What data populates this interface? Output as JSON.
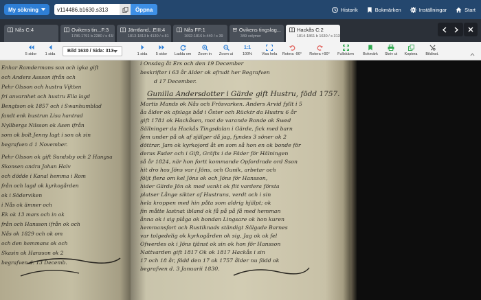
{
  "topbar": {
    "my_search_label": "My sökning",
    "search_value": "v114486.b1630.s313",
    "open_label": "Öppna",
    "links": [
      {
        "label": "Historik",
        "icon": "history-icon"
      },
      {
        "label": "Bokmärken",
        "icon": "bookmark-icon"
      },
      {
        "label": "Inställningar",
        "icon": "gear-icon"
      },
      {
        "label": "Start",
        "icon": "home-icon"
      }
    ]
  },
  "tabs": [
    {
      "title": "Nås C:4",
      "subtitle": ""
    },
    {
      "title": "Ovikens tin...F:3",
      "subtitle": "1786-1791 b 2280 / s 43/"
    },
    {
      "title": "Jämtland...EIII:4",
      "subtitle": "1813-1813 b 4130 / s 81"
    },
    {
      "title": "Nås FF:1",
      "subtitle": "1692-1816 b 440 / s 39"
    },
    {
      "title": "Ovikens tingslag...",
      "subtitle": "349 volymer"
    },
    {
      "title": "Hackås C:2",
      "subtitle": "1814-1861 b 1630 / s 313"
    }
  ],
  "toolbar": {
    "page_select": "Bild 1630 / Sida: 313",
    "items": [
      {
        "label": "5 sidor",
        "icon": "double-left-icon"
      },
      {
        "label": "1 sida",
        "icon": "left-icon"
      },
      {
        "label": "1 sida",
        "icon": "right-icon"
      },
      {
        "label": "5 sidor",
        "icon": "double-right-icon"
      },
      {
        "label": "Ladda om",
        "icon": "reload-icon"
      },
      {
        "label": "Zoom in",
        "icon": "zoom-in-icon"
      },
      {
        "label": "Zoom ut",
        "icon": "zoom-out-icon"
      },
      {
        "label": "100%",
        "icon": "zoom-100-icon",
        "glyph": "1:1"
      },
      {
        "label": "Visa hela",
        "icon": "fit-icon"
      },
      {
        "label": "Rotera -90°",
        "icon": "rotate-left-icon"
      },
      {
        "label": "Rotera +90°",
        "icon": "rotate-right-icon"
      },
      {
        "label": "Fullskärm",
        "icon": "fullscreen-icon"
      },
      {
        "label": "Bokmärk",
        "icon": "bookmark-add-icon"
      },
      {
        "label": "Skriv ut",
        "icon": "print-icon"
      },
      {
        "label": "Kopiera",
        "icon": "copy-icon"
      },
      {
        "label": "Bildinst.",
        "icon": "image-settings-icon"
      }
    ]
  },
  "document": {
    "left_lines": [
      "Enhar Ramdermans son och igka gift",
      "och Anders Assson ifrån och",
      "Pehr Olsson och hustru Vijtten",
      "fri anvarnhet och hustru Ella lagd",
      "Bengtson ok 1857 och i Swanhumblad",
      "fandt enk hustrun Lisa hantrad",
      "Nyllbergs Nilsson ok Asen ifrån",
      "som ok bolt Jenny lagt i son ok sin",
      "begrafven d 1 November.",
      "Pehr Olsson ok gift Sundsby och 2 Hangsa",
      "Skonsen andra Johan Halv",
      "och dödde i Kanal hemma i Rom",
      "från och lagd ok kyrkogården",
      "ok i Söderviken",
      "i Nås ok ämner och",
      "Ek ok 13 mars och in ok",
      "från och Hansson ifrån ok och",
      "Nås ok 1829 och ok om",
      "och den hemmans ok och",
      "Skasin ok Hansson ok 2",
      "begrafven d. 13 Decemb."
    ],
    "right_lines": [
      "i Onsdag åt Ers och den 19 December",
      "beskrifter i 63 år Alder ok afrudt her Begrafven",
      "d 17 December.",
      "Gunilla Andersdotter i Gärde gift Hustru, född 1757.",
      "Martis Mands ok Nås och Frösvarken. Anders Arvid fyllt i 5",
      "åa ålder ok afslags båd i Öster och Rücktr da Hustru 6 år",
      "gift 1781 ok Hackåsen, mot de varande Bonde ok Swed",
      "Sällninger da Hackås Tingsdalan i Gärde, fick med barn",
      "fem under på ok af själger då jag, fyndes 3 söner ok 2",
      "döttrar. Jam ok kyrkojord åt en som så hon en ok bonde för",
      "deras Fader och i Gift, Gräfts i de Fäder för Hälningen",
      "så år 1824, när hon fortt kommande Opfordrade ord Sson",
      "hit dro hos Jöns var i Jöns, och Gunik, arbetar och",
      "följt flera om kel Jöns ok och Jöns för Hansson,",
      "hider Gärde Jön ok med vankt ok flit vardera första",
      "platser Långe sikter af Hustruns, verdt och i sin",
      "hela kroppen med hin påta som aldrig hjälpt; ok",
      "fin måtte lastnat ibland ok få på på få med hemman",
      "ånna ok i sig plåga ok bondan Lingsare ok hon kuren",
      "hemmansfort och Rustiknads ständigt Sälgade Barnes",
      "var tolgedelig ok kyrkogården ok sig, Jag ok ok fel",
      "Ofwerdes ok i Jöns tjänst ok sin ok hon för Hansson",
      "Nattvarden gift 1817 Ok ok 1817 Hackås i sin",
      "17 och 18 år, född den 17 ok 1757 ålder nu född ok",
      "begrafven d. 3 Januarii 1830."
    ]
  }
}
